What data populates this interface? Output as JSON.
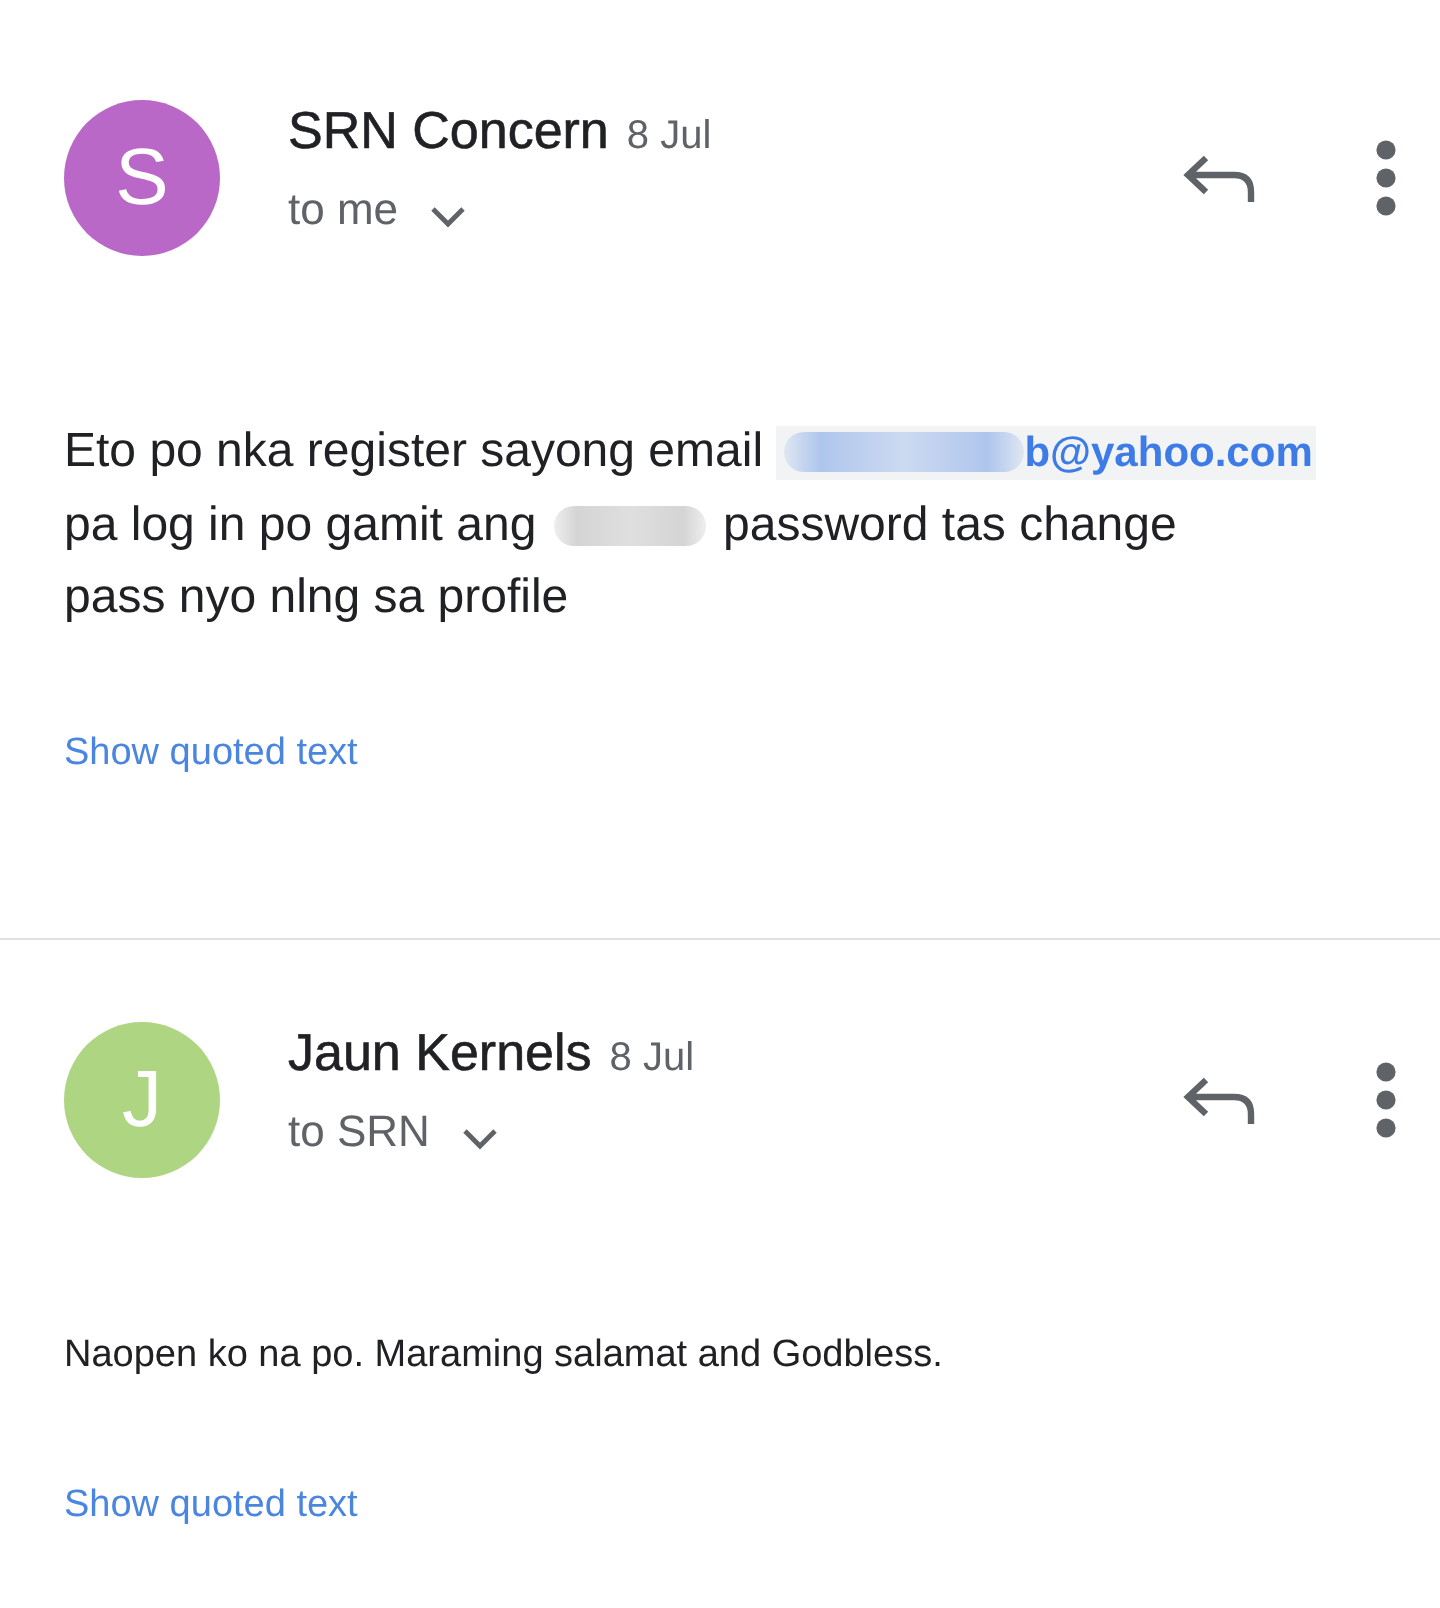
{
  "messages": [
    {
      "kind": "formatted",
      "avatar": {
        "letter": "S",
        "color": "#ba68c8"
      },
      "sender": "SRN Concern",
      "date": "8 Jul",
      "recipient": "to me",
      "body": [
        {
          "kind": "text",
          "text": "Eto po nka register sayong email "
        },
        {
          "kind": "link",
          "redacted_prefix": true,
          "text": "b@yahoo.com"
        },
        {
          "kind": "text",
          "text": "\npa log in po gamit ang "
        },
        {
          "kind": "redacted"
        },
        {
          "kind": "text",
          "text": " password tas change\npass nyo nlng sa profile"
        }
      ],
      "quoted_link": "Show quoted text"
    },
    {
      "kind": "plain",
      "avatar": {
        "letter": "J",
        "color": "#aed581"
      },
      "sender": "Jaun Kernels",
      "date": "8 Jul",
      "recipient": "to SRN",
      "body": [
        {
          "kind": "text",
          "text": "Naopen ko na po. Maraming salamat and Godbless."
        }
      ],
      "quoted_link": "Show quoted text"
    }
  ]
}
